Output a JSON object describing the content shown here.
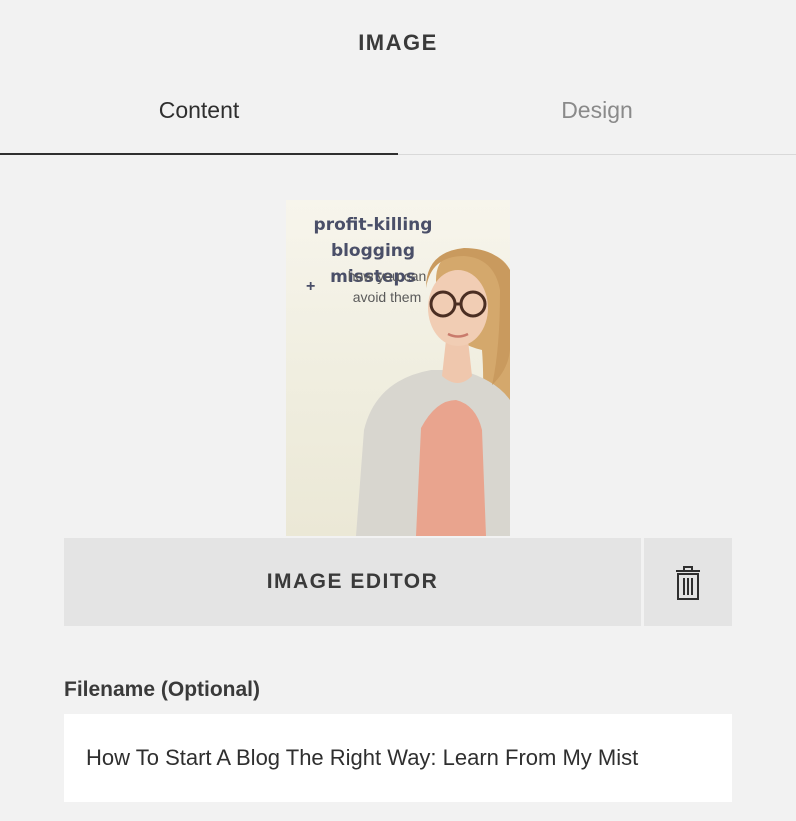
{
  "panel": {
    "title": "IMAGE"
  },
  "tabs": [
    {
      "label": "Content",
      "active": true
    },
    {
      "label": "Design",
      "active": false
    }
  ],
  "image": {
    "line1": "profit-killing",
    "line2": "blogging missteps",
    "plus": "+",
    "sub1": "how you can",
    "sub2": "avoid them"
  },
  "actions": {
    "editor_label": "IMAGE EDITOR",
    "delete_icon": "trash-icon"
  },
  "filename": {
    "label": "Filename (Optional)",
    "value": "How To Start A Blog The Right Way: Learn From My Mist"
  },
  "colors": {
    "background": "#f2f2f2",
    "button_bg": "#e4e4e4",
    "active_tab": "#2f2f2f",
    "inactive_tab": "#8a8a8a"
  }
}
